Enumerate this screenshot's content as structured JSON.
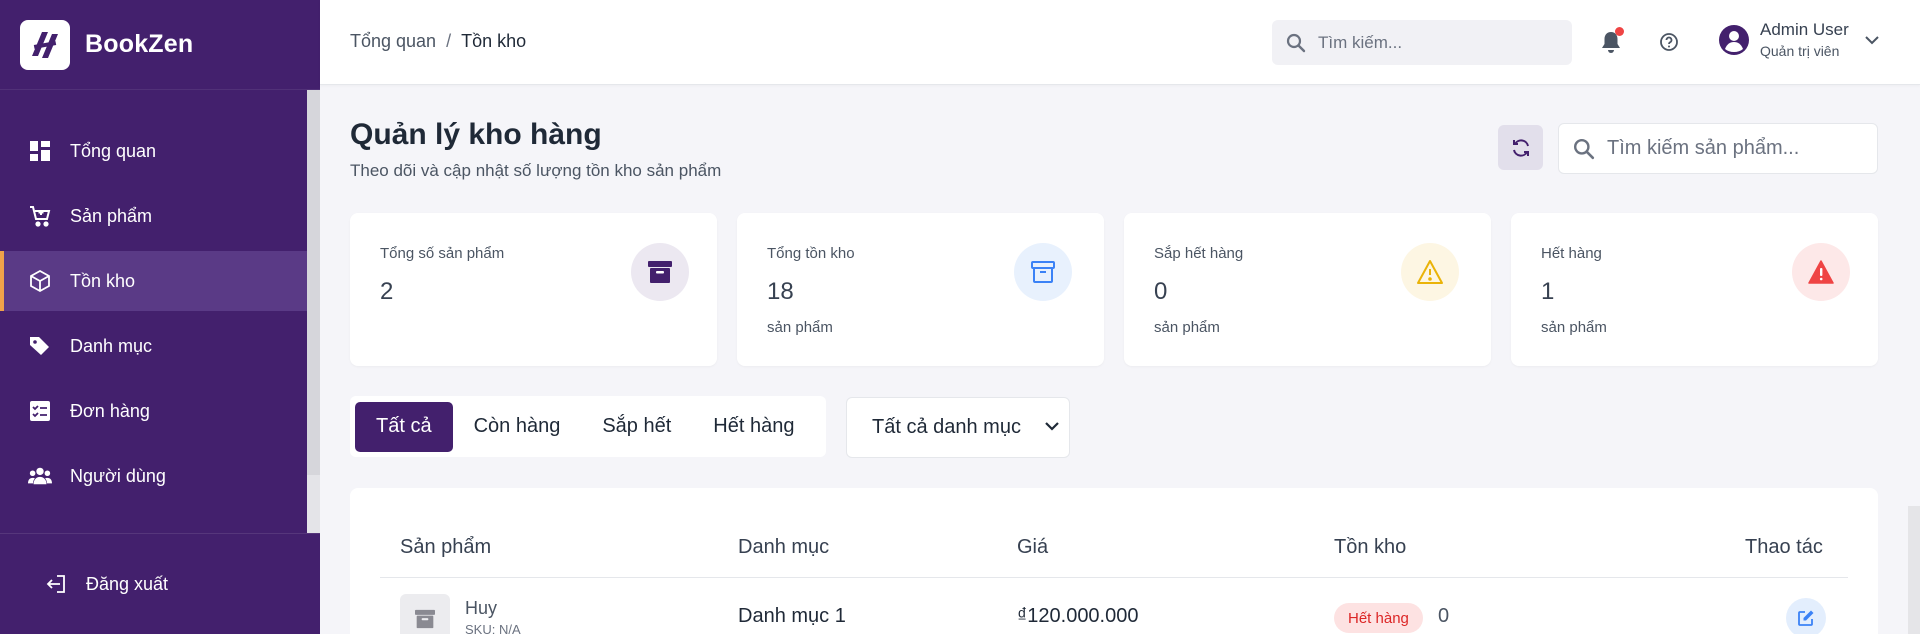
{
  "brand": {
    "name": "BookZen"
  },
  "sidebar": {
    "items": [
      {
        "label": "Tổng quan",
        "icon": "dashboard-icon",
        "active": false
      },
      {
        "label": "Sản phẩm",
        "icon": "cart-icon",
        "active": false
      },
      {
        "label": "Tồn kho",
        "icon": "box-icon",
        "active": true
      },
      {
        "label": "Danh mục",
        "icon": "tags-icon",
        "active": false
      },
      {
        "label": "Đơn hàng",
        "icon": "checklist-icon",
        "active": false
      },
      {
        "label": "Người dùng",
        "icon": "users-icon",
        "active": false
      }
    ],
    "logout_label": "Đăng xuất"
  },
  "topbar": {
    "breadcrumb": [
      "Tổng quan",
      "Tồn kho"
    ],
    "breadcrumb_sep": "/",
    "search_placeholder": "Tìm kiếm...",
    "user_name": "Admin User",
    "user_role": "Quản trị viên"
  },
  "page": {
    "title": "Quản lý kho hàng",
    "subtitle": "Theo dõi và cập nhật số lượng tồn kho sản phẩm",
    "search_placeholder": "Tìm kiếm sản phẩm..."
  },
  "stats": [
    {
      "label": "Tổng số sản phẩm",
      "value": "2",
      "unit": "",
      "icon": "archive-icon",
      "color": "#43206d",
      "bg": "#ece8f1"
    },
    {
      "label": "Tổng tồn kho",
      "value": "18",
      "unit": "sản phẩm",
      "icon": "archive-outline-icon",
      "color": "#3b82f6",
      "bg": "#e8f1fd"
    },
    {
      "label": "Sắp hết hàng",
      "value": "0",
      "unit": "sản phẩm",
      "icon": "warning-icon",
      "color": "#eab308",
      "bg": "#fdf6e3"
    },
    {
      "label": "Hết hàng",
      "value": "1",
      "unit": "sản phẩm",
      "icon": "alert-icon",
      "color": "#ef4444",
      "bg": "#fde8e8"
    }
  ],
  "filters": {
    "tabs": [
      "Tất cả",
      "Còn hàng",
      "Sắp hết",
      "Hết hàng"
    ],
    "active_tab": 0,
    "category_select": "Tất cả danh mục"
  },
  "table": {
    "headers": [
      "Sản phẩm",
      "Danh mục",
      "Giá",
      "Tồn kho",
      "Thao tác"
    ],
    "rows": [
      {
        "name": "Huy",
        "sku": "SKU: N/A",
        "category": "Danh mục 1",
        "price": "₫120.000.000",
        "status": "Hết hàng",
        "stock": "0"
      }
    ]
  }
}
